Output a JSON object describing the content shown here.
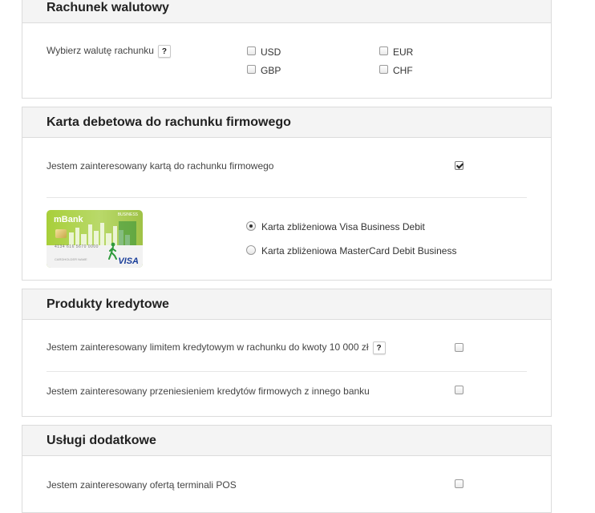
{
  "sections": {
    "currency": {
      "title": "Rachunek walutowy",
      "question": "Wybierz walutę rachunku",
      "help": "?",
      "options": [
        {
          "label": "USD",
          "checked": false
        },
        {
          "label": "EUR",
          "checked": false
        },
        {
          "label": "GBP",
          "checked": false
        },
        {
          "label": "CHF",
          "checked": false
        }
      ]
    },
    "debit_card": {
      "title": "Karta debetowa do rachunku firmowego",
      "interest_label": "Jestem zainteresowany kartą do rachunku firmowego",
      "interest_checked": true,
      "card": {
        "brand": "mBank",
        "tag": "BUSINESS",
        "number": "4134 616 5670 0000",
        "holder": "CARDHOLDER NAME",
        "network": "VISA"
      },
      "card_types": [
        {
          "label": "Karta zbliżeniowa Visa Business Debit",
          "selected": true
        },
        {
          "label": "Karta zbliżeniowa MasterCard Debit Business",
          "selected": false
        }
      ]
    },
    "credit": {
      "title": "Produkty kredytowe",
      "items": [
        {
          "label": "Jestem zainteresowany limitem kredytowym w rachunku do kwoty 10 000 zł",
          "help": "?",
          "checked": false
        },
        {
          "label": "Jestem zainteresowany przeniesieniem kredytów firmowych z innego banku",
          "checked": false
        }
      ]
    },
    "extras": {
      "title": "Usługi dodatkowe",
      "items": [
        {
          "label": "Jestem zainteresowany ofertą terminali POS",
          "checked": false
        }
      ]
    }
  },
  "colors": {
    "panel_header_bg": "#f4f4f4",
    "panel_border": "#dcdcdc",
    "card_green": "#a8cf3a",
    "visa_blue": "#1a3e9a"
  }
}
